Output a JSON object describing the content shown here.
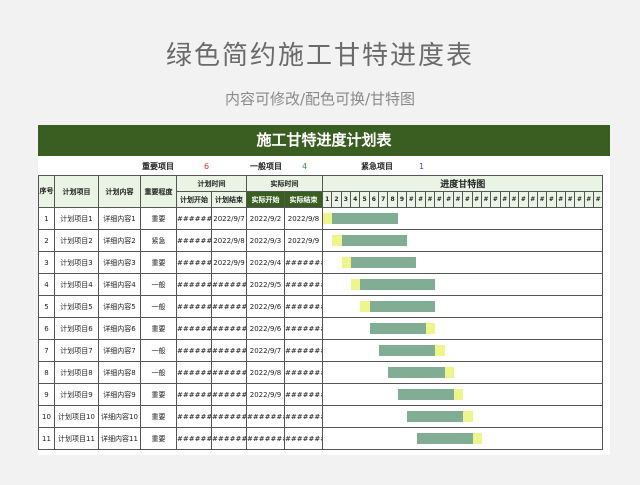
{
  "page": {
    "title": "绿色简约施工甘特进度表",
    "subtitle": "内容可修改/配色可换/甘特图"
  },
  "sheet": {
    "banner": "施工甘特进度计划表",
    "legend": {
      "important_label": "重要项目",
      "important_count": "6",
      "normal_label": "一般项目",
      "normal_count": "4",
      "urgent_label": "紧急项目",
      "urgent_count": "1"
    },
    "colors": {
      "banner": "#3a5e22",
      "header_bg": "#eaf4e4",
      "bar_actual": "#82ad95",
      "bar_extra": "#eef58d",
      "important": "#e03030",
      "normal": "#2a9a3a",
      "urgent": "#6a3ab0"
    },
    "headers": {
      "seq": "序号",
      "plan_item": "计划项目",
      "plan_content": "计划内容",
      "importance": "重要程度",
      "plan_time": "计划时间",
      "actual_time": "实际时间",
      "gantt": "进度甘特图",
      "plan_start": "计划开始",
      "plan_end": "计划结束",
      "actual_start": "实际开始",
      "actual_end": "实际结束"
    },
    "day_labels": [
      "1",
      "2",
      "3",
      "4",
      "5",
      "6",
      "7",
      "8",
      "9",
      "#",
      "#",
      "#",
      "#",
      "#",
      "#",
      "#",
      "#",
      "#",
      "#",
      "#",
      "#",
      "#",
      "#",
      "#",
      "#",
      "#",
      "#",
      "#",
      "#",
      "#"
    ],
    "rows": [
      {
        "seq": "1",
        "item": "计划项目1",
        "content": "详细内容1",
        "level": "重要",
        "plan_start": "########",
        "plan_end": "2022/9/7",
        "actual_start": "2022/9/2",
        "actual_end": "2022/9/8",
        "pre_days": 1,
        "main_days": 7,
        "post_days": 0
      },
      {
        "seq": "2",
        "item": "计划项目2",
        "content": "详细内容2",
        "level": "紧急",
        "plan_start": "########",
        "plan_end": "2022/9/8",
        "actual_start": "2022/9/3",
        "actual_end": "2022/9/9",
        "pre_days": 1,
        "main_days": 7,
        "post_days": 0
      },
      {
        "seq": "3",
        "item": "计划项目3",
        "content": "详细内容3",
        "level": "重要",
        "plan_start": "########",
        "plan_end": "2022/9/9",
        "actual_start": "2022/9/4",
        "actual_end": "########",
        "pre_days": 1,
        "main_days": 7,
        "post_days": 0
      },
      {
        "seq": "4",
        "item": "计划项目4",
        "content": "详细内容4",
        "level": "一般",
        "plan_start": "########",
        "plan_end": "########",
        "actual_start": "2022/9/5",
        "actual_end": "########",
        "pre_days": 1,
        "main_days": 8,
        "post_days": 0
      },
      {
        "seq": "5",
        "item": "计划项目5",
        "content": "详细内容5",
        "level": "一般",
        "plan_start": "########",
        "plan_end": "########",
        "actual_start": "2022/9/6",
        "actual_end": "########",
        "pre_days": 1,
        "main_days": 7,
        "post_days": 0
      },
      {
        "seq": "6",
        "item": "计划项目6",
        "content": "详细内容6",
        "level": "重要",
        "plan_start": "########",
        "plan_end": "########",
        "actual_start": "2022/9/6",
        "actual_end": "########",
        "pre_days": 0,
        "main_days": 6,
        "post_days": 1
      },
      {
        "seq": "7",
        "item": "计划项目7",
        "content": "详细内容7",
        "level": "一般",
        "plan_start": "########",
        "plan_end": "########",
        "actual_start": "2022/9/7",
        "actual_end": "########",
        "pre_days": 0,
        "main_days": 6,
        "post_days": 1
      },
      {
        "seq": "8",
        "item": "计划项目8",
        "content": "详细内容8",
        "level": "一般",
        "plan_start": "########",
        "plan_end": "########",
        "actual_start": "2022/9/8",
        "actual_end": "########",
        "pre_days": 0,
        "main_days": 6,
        "post_days": 1
      },
      {
        "seq": "9",
        "item": "计划项目9",
        "content": "详细内容9",
        "level": "重要",
        "plan_start": "########",
        "plan_end": "########",
        "actual_start": "2022/9/9",
        "actual_end": "########",
        "pre_days": 0,
        "main_days": 6,
        "post_days": 1
      },
      {
        "seq": "10",
        "item": "计划项目10",
        "content": "详细内容10",
        "level": "重要",
        "plan_start": "########",
        "plan_end": "########",
        "actual_start": "########",
        "actual_end": "########",
        "pre_days": 0,
        "main_days": 6,
        "post_days": 1
      },
      {
        "seq": "11",
        "item": "计划项目11",
        "content": "详细内容11",
        "level": "重要",
        "plan_start": "########",
        "plan_end": "########",
        "actual_start": "########",
        "actual_end": "########",
        "pre_days": 0,
        "main_days": 6,
        "post_days": 1
      }
    ]
  }
}
